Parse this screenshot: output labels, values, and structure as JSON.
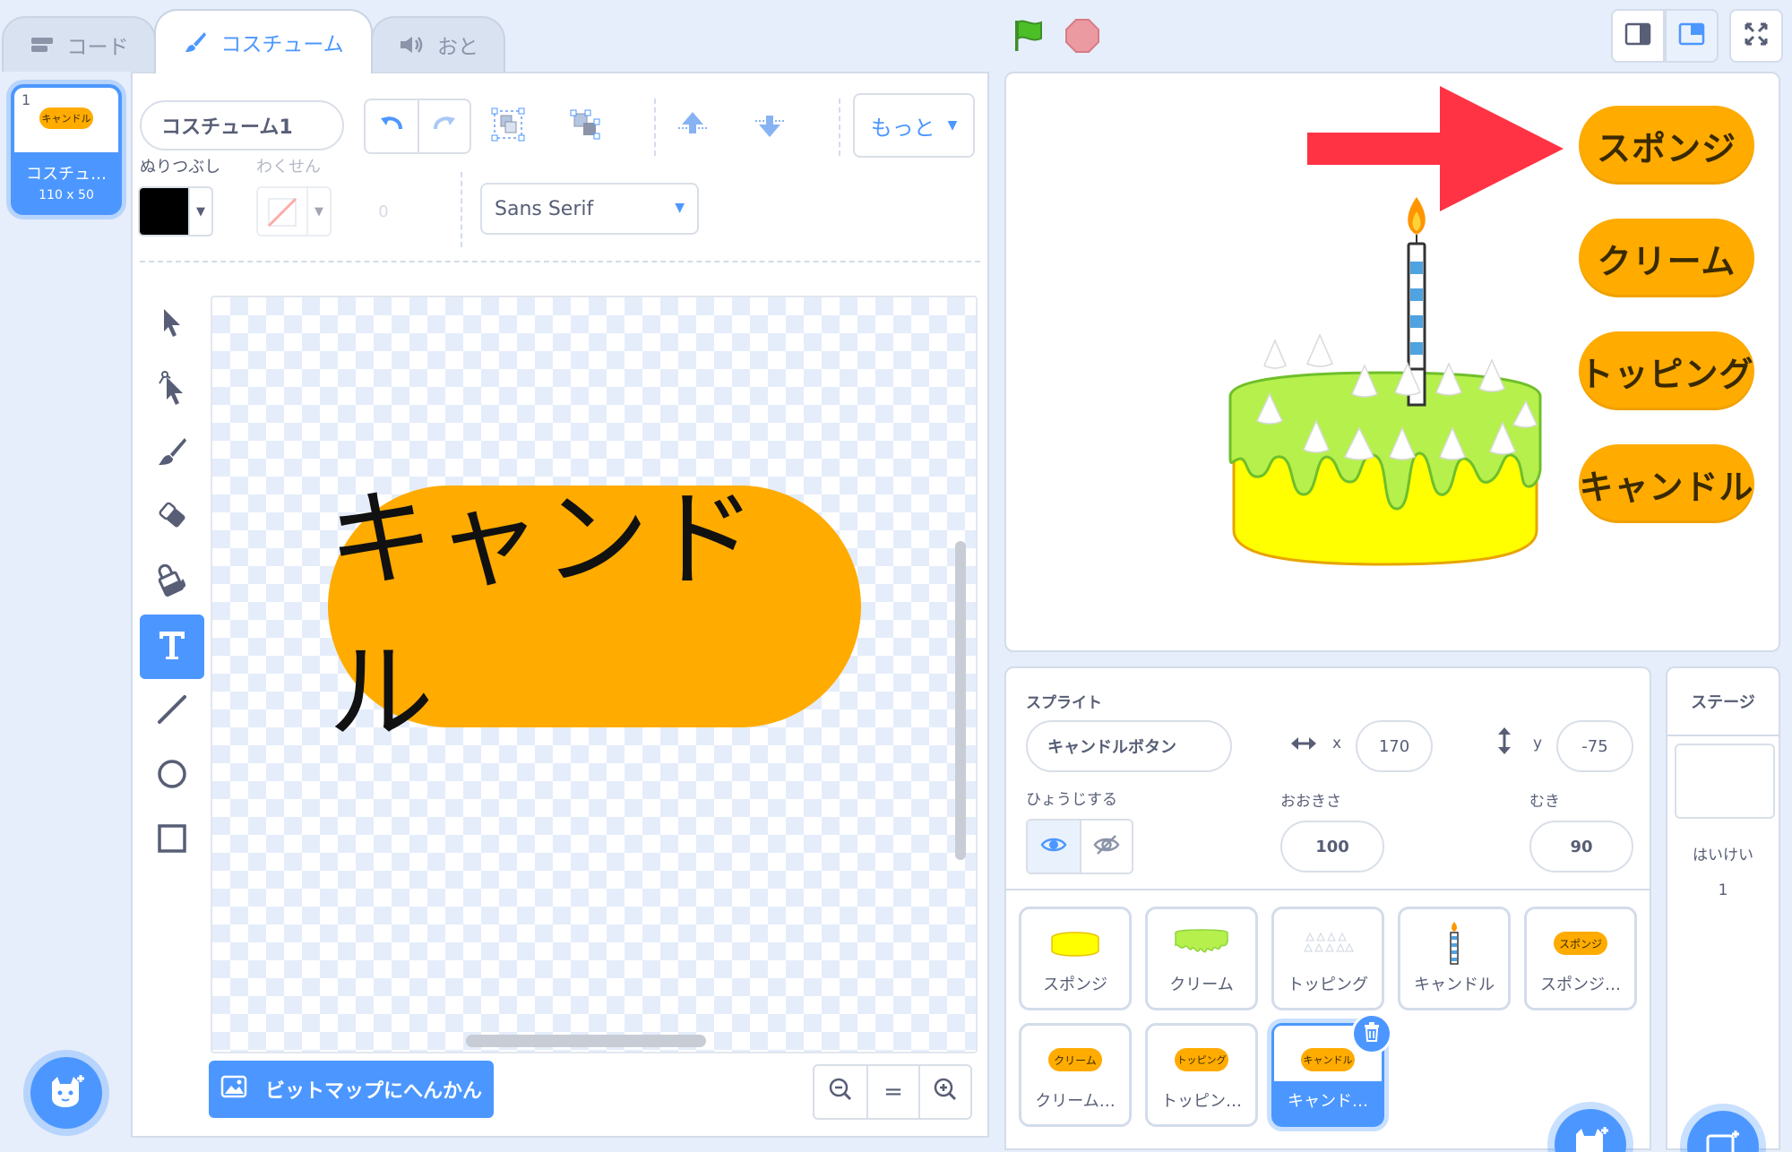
{
  "tabs": [
    {
      "label": "コード",
      "icon": "code-blocks-icon"
    },
    {
      "label": "コスチューム",
      "icon": "brush-icon"
    },
    {
      "label": "おと",
      "icon": "speaker-icon"
    }
  ],
  "costume_list": {
    "items": [
      {
        "number": "1",
        "name": "コスチュ…",
        "size": "110 x 50",
        "thumb_text": "キャンドル"
      }
    ]
  },
  "editor": {
    "costume_name": "コスチューム1",
    "more_label": "もっと",
    "fill_label": "ぬりつぶし",
    "outline_label": "わくせん",
    "outline_width": "0",
    "font": "Sans Serif",
    "canvas_text": "キャンドル",
    "convert_label": "ビットマップにへんかん",
    "zoom_reset": "="
  },
  "stage": {
    "buttons": [
      "スポンジ",
      "クリーム",
      "トッピング",
      "キャンドル"
    ]
  },
  "sprite_info": {
    "section_label": "スプライト",
    "name": "キャンドルボタン",
    "x_label": "x",
    "x": "170",
    "y_label": "y",
    "y": "-75",
    "show_label": "ひょうじする",
    "size_label": "おおきさ",
    "size": "100",
    "direction_label": "むき",
    "direction": "90"
  },
  "sprites": [
    {
      "name": "スポンジ",
      "thumb": "sponge"
    },
    {
      "name": "クリーム",
      "thumb": "cream"
    },
    {
      "name": "トッピング",
      "thumb": "topping"
    },
    {
      "name": "キャンドル",
      "thumb": "candle"
    },
    {
      "name": "スポンジ…",
      "thumb_text": "スポンジ"
    },
    {
      "name": "クリーム…",
      "thumb_text": "クリーム"
    },
    {
      "name": "トッピン…",
      "thumb_text": "トッピング"
    },
    {
      "name": "キャンド…",
      "thumb_text": "キャンドル",
      "selected": true
    }
  ],
  "stage_panel": {
    "header": "ステージ",
    "backdrops_label": "はいけい",
    "backdrops_count": "1"
  },
  "colors": {
    "accent": "#4c97ff",
    "button_orange": "#ffab00",
    "fill_color": "#000000",
    "arrow_red": "#ff3344"
  }
}
